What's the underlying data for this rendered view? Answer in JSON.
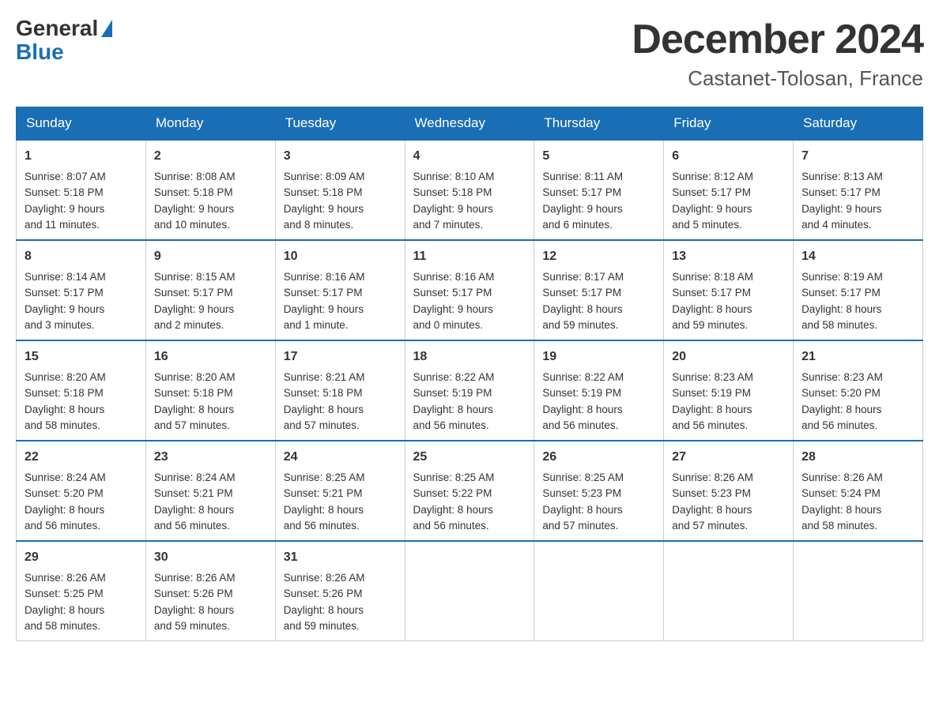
{
  "logo": {
    "general": "General",
    "blue": "Blue"
  },
  "header": {
    "month": "December 2024",
    "location": "Castanet-Tolosan, France"
  },
  "days": [
    "Sunday",
    "Monday",
    "Tuesday",
    "Wednesday",
    "Thursday",
    "Friday",
    "Saturday"
  ],
  "weeks": [
    [
      {
        "day": "1",
        "sunrise": "8:07 AM",
        "sunset": "5:18 PM",
        "daylight": "9 hours and 11 minutes."
      },
      {
        "day": "2",
        "sunrise": "8:08 AM",
        "sunset": "5:18 PM",
        "daylight": "9 hours and 10 minutes."
      },
      {
        "day": "3",
        "sunrise": "8:09 AM",
        "sunset": "5:18 PM",
        "daylight": "9 hours and 8 minutes."
      },
      {
        "day": "4",
        "sunrise": "8:10 AM",
        "sunset": "5:18 PM",
        "daylight": "9 hours and 7 minutes."
      },
      {
        "day": "5",
        "sunrise": "8:11 AM",
        "sunset": "5:17 PM",
        "daylight": "9 hours and 6 minutes."
      },
      {
        "day": "6",
        "sunrise": "8:12 AM",
        "sunset": "5:17 PM",
        "daylight": "9 hours and 5 minutes."
      },
      {
        "day": "7",
        "sunrise": "8:13 AM",
        "sunset": "5:17 PM",
        "daylight": "9 hours and 4 minutes."
      }
    ],
    [
      {
        "day": "8",
        "sunrise": "8:14 AM",
        "sunset": "5:17 PM",
        "daylight": "9 hours and 3 minutes."
      },
      {
        "day": "9",
        "sunrise": "8:15 AM",
        "sunset": "5:17 PM",
        "daylight": "9 hours and 2 minutes."
      },
      {
        "day": "10",
        "sunrise": "8:16 AM",
        "sunset": "5:17 PM",
        "daylight": "9 hours and 1 minute."
      },
      {
        "day": "11",
        "sunrise": "8:16 AM",
        "sunset": "5:17 PM",
        "daylight": "9 hours and 0 minutes."
      },
      {
        "day": "12",
        "sunrise": "8:17 AM",
        "sunset": "5:17 PM",
        "daylight": "8 hours and 59 minutes."
      },
      {
        "day": "13",
        "sunrise": "8:18 AM",
        "sunset": "5:17 PM",
        "daylight": "8 hours and 59 minutes."
      },
      {
        "day": "14",
        "sunrise": "8:19 AM",
        "sunset": "5:17 PM",
        "daylight": "8 hours and 58 minutes."
      }
    ],
    [
      {
        "day": "15",
        "sunrise": "8:20 AM",
        "sunset": "5:18 PM",
        "daylight": "8 hours and 58 minutes."
      },
      {
        "day": "16",
        "sunrise": "8:20 AM",
        "sunset": "5:18 PM",
        "daylight": "8 hours and 57 minutes."
      },
      {
        "day": "17",
        "sunrise": "8:21 AM",
        "sunset": "5:18 PM",
        "daylight": "8 hours and 57 minutes."
      },
      {
        "day": "18",
        "sunrise": "8:22 AM",
        "sunset": "5:19 PM",
        "daylight": "8 hours and 56 minutes."
      },
      {
        "day": "19",
        "sunrise": "8:22 AM",
        "sunset": "5:19 PM",
        "daylight": "8 hours and 56 minutes."
      },
      {
        "day": "20",
        "sunrise": "8:23 AM",
        "sunset": "5:19 PM",
        "daylight": "8 hours and 56 minutes."
      },
      {
        "day": "21",
        "sunrise": "8:23 AM",
        "sunset": "5:20 PM",
        "daylight": "8 hours and 56 minutes."
      }
    ],
    [
      {
        "day": "22",
        "sunrise": "8:24 AM",
        "sunset": "5:20 PM",
        "daylight": "8 hours and 56 minutes."
      },
      {
        "day": "23",
        "sunrise": "8:24 AM",
        "sunset": "5:21 PM",
        "daylight": "8 hours and 56 minutes."
      },
      {
        "day": "24",
        "sunrise": "8:25 AM",
        "sunset": "5:21 PM",
        "daylight": "8 hours and 56 minutes."
      },
      {
        "day": "25",
        "sunrise": "8:25 AM",
        "sunset": "5:22 PM",
        "daylight": "8 hours and 56 minutes."
      },
      {
        "day": "26",
        "sunrise": "8:25 AM",
        "sunset": "5:23 PM",
        "daylight": "8 hours and 57 minutes."
      },
      {
        "day": "27",
        "sunrise": "8:26 AM",
        "sunset": "5:23 PM",
        "daylight": "8 hours and 57 minutes."
      },
      {
        "day": "28",
        "sunrise": "8:26 AM",
        "sunset": "5:24 PM",
        "daylight": "8 hours and 58 minutes."
      }
    ],
    [
      {
        "day": "29",
        "sunrise": "8:26 AM",
        "sunset": "5:25 PM",
        "daylight": "8 hours and 58 minutes."
      },
      {
        "day": "30",
        "sunrise": "8:26 AM",
        "sunset": "5:26 PM",
        "daylight": "8 hours and 59 minutes."
      },
      {
        "day": "31",
        "sunrise": "8:26 AM",
        "sunset": "5:26 PM",
        "daylight": "8 hours and 59 minutes."
      },
      null,
      null,
      null,
      null
    ]
  ],
  "labels": {
    "sunrise": "Sunrise:",
    "sunset": "Sunset:",
    "daylight": "Daylight:"
  }
}
